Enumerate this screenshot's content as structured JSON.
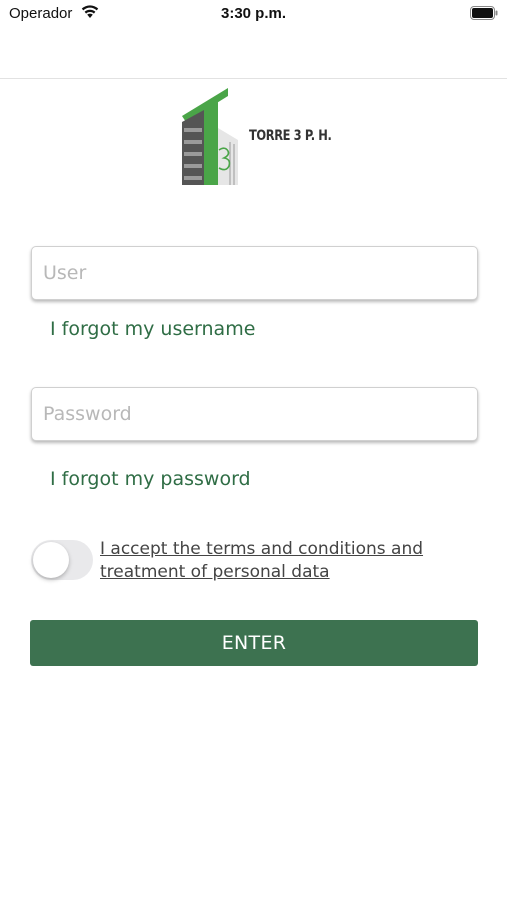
{
  "status_bar": {
    "carrier": "Operador",
    "time": "3:30 p.m.",
    "icons": [
      "wifi-icon",
      "battery-icon"
    ]
  },
  "logo": {
    "text": "TORRE 3 P. H.",
    "numeral": "3",
    "colors": {
      "green": "#4aa548",
      "dark_gray": "#555555"
    }
  },
  "form": {
    "user_placeholder": "User",
    "user_value": "",
    "forgot_username": "I forgot my username",
    "password_placeholder": "Password",
    "password_value": "",
    "forgot_password": "I forgot my password",
    "terms_label": "I accept the terms and conditions and treatment of personal data",
    "terms_accepted": false,
    "enter_label": "ENTER"
  },
  "colors": {
    "accent": "#3d7250",
    "link": "#2f6d45",
    "toggle_off": "#e9e9eb"
  }
}
